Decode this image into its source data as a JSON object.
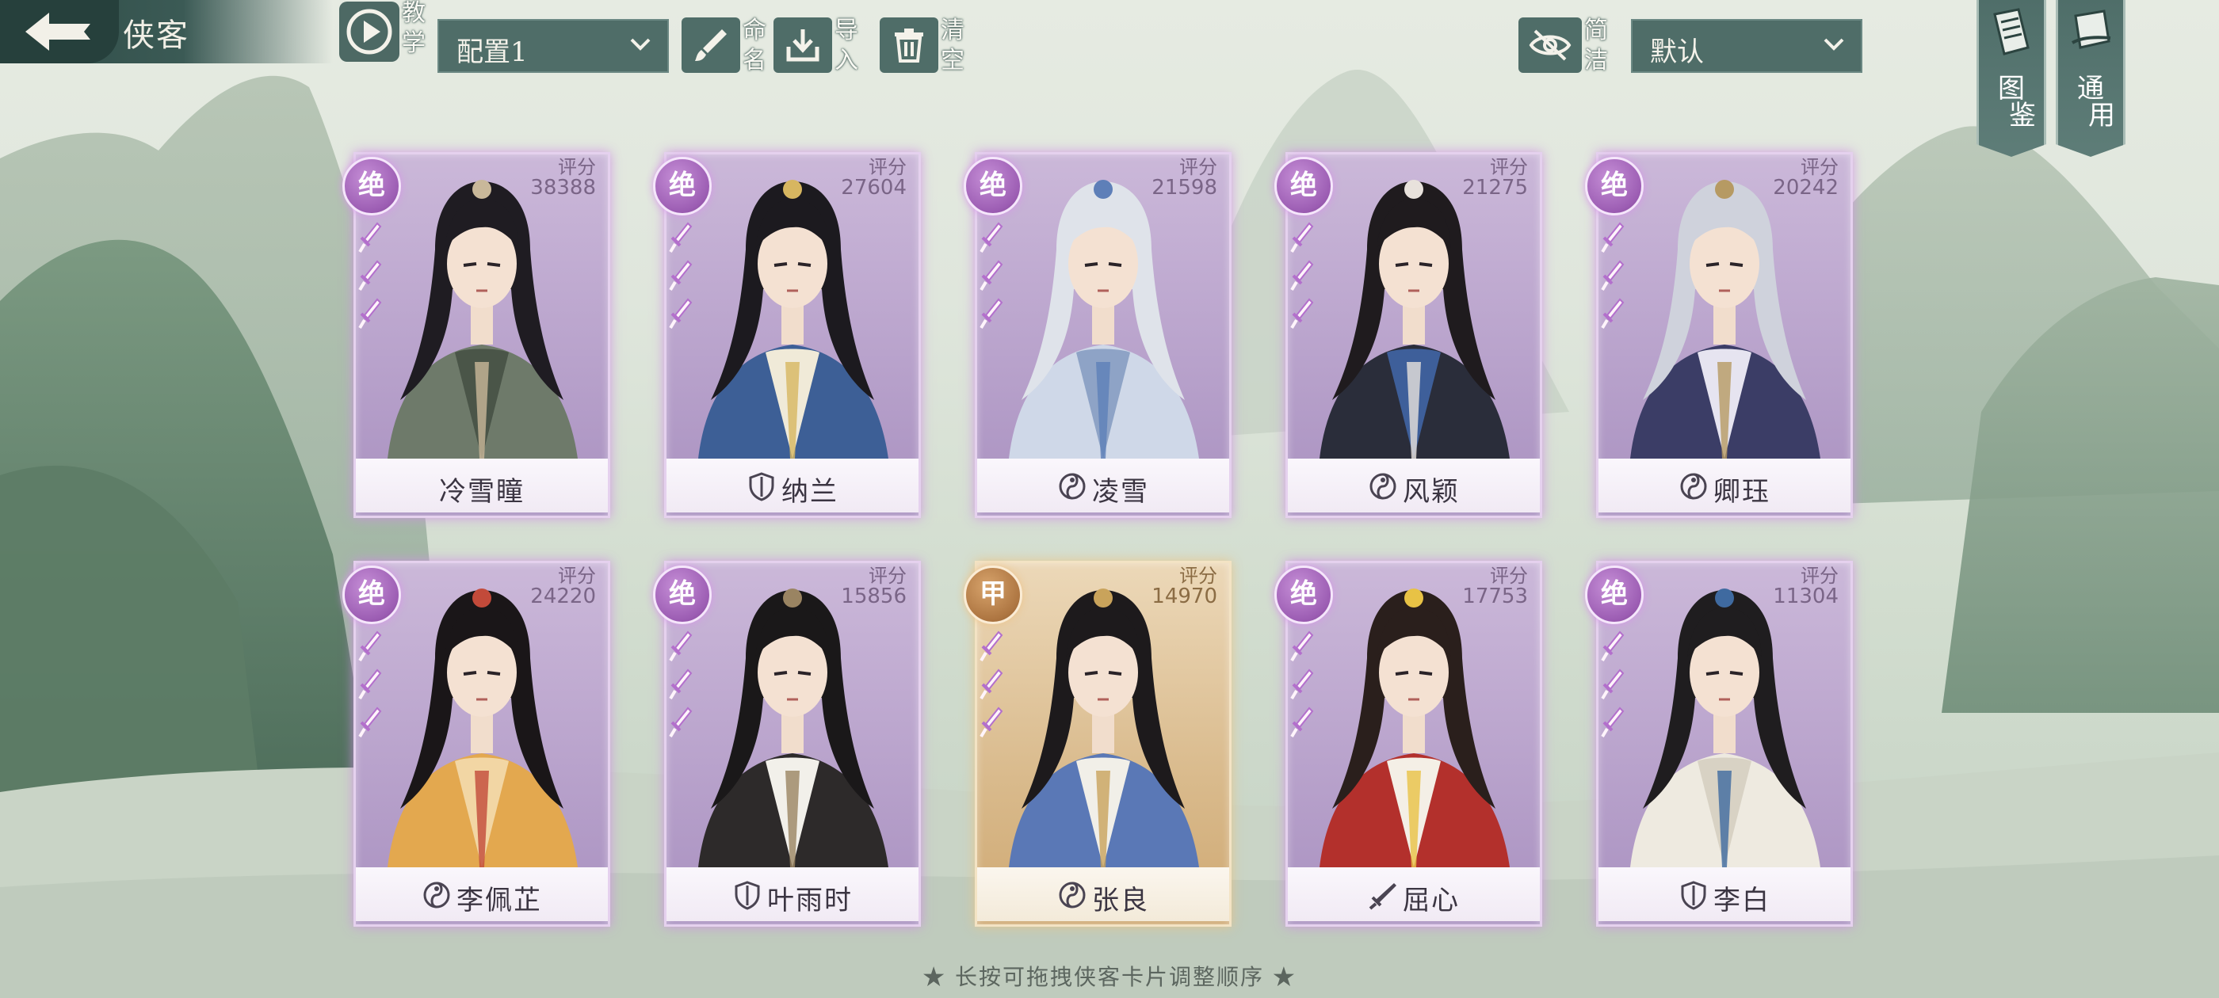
{
  "header": {
    "title": "侠客",
    "tutorial_label": [
      "教",
      "学"
    ],
    "config_select": "配置1",
    "rename_label": [
      "命",
      "名"
    ],
    "import_label": [
      "导",
      "入"
    ],
    "clear_label": [
      "清",
      "空"
    ],
    "simple_label": [
      "简",
      "洁"
    ],
    "sort_select": "默认",
    "codex_label": [
      "图",
      "鉴"
    ],
    "general_label": [
      "通",
      "用"
    ]
  },
  "score_label": "评分",
  "heroes": [
    {
      "name": "冷雪瞳",
      "score": "38388",
      "rank": "绝",
      "tier": "purple",
      "class_icon": "none",
      "swords": 3
    },
    {
      "name": "纳兰",
      "score": "27604",
      "rank": "绝",
      "tier": "purple",
      "class_icon": "shield-icon",
      "swords": 3
    },
    {
      "name": "凌雪",
      "score": "21598",
      "rank": "绝",
      "tier": "purple",
      "class_icon": "taiji-icon",
      "swords": 3
    },
    {
      "name": "风颖",
      "score": "21275",
      "rank": "绝",
      "tier": "purple",
      "class_icon": "taiji-icon",
      "swords": 3
    },
    {
      "name": "卿珏",
      "score": "20242",
      "rank": "绝",
      "tier": "purple",
      "class_icon": "taiji-icon",
      "swords": 3
    },
    {
      "name": "李佩芷",
      "score": "24220",
      "rank": "绝",
      "tier": "purple",
      "class_icon": "taiji-icon",
      "swords": 3
    },
    {
      "name": "叶雨时",
      "score": "15856",
      "rank": "绝",
      "tier": "purple",
      "class_icon": "shield-icon",
      "swords": 3
    },
    {
      "name": "张良",
      "score": "14970",
      "rank": "甲",
      "tier": "gold",
      "class_icon": "taiji-icon",
      "swords": 3
    },
    {
      "name": "屈心",
      "score": "17753",
      "rank": "绝",
      "tier": "purple",
      "class_icon": "sword-icon",
      "swords": 3
    },
    {
      "name": "李白",
      "score": "11304",
      "rank": "绝",
      "tier": "purple",
      "class_icon": "shield-icon",
      "swords": 3
    }
  ],
  "footer_hint": "★ 长按可拖拽侠客卡片调整顺序 ★",
  "colors": {
    "accent_teal": "#4f6d68",
    "purple_rank": "#9c5db3",
    "gold_rank": "#ad7541"
  }
}
